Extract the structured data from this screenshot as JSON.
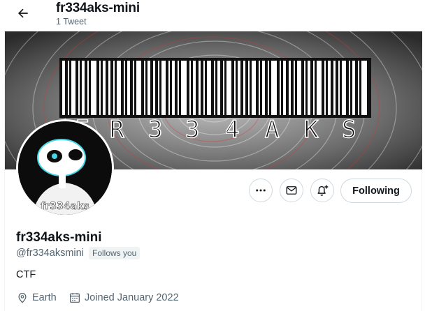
{
  "header": {
    "title": "fr334aks-mini",
    "subtitle": "1 Tweet"
  },
  "banner": {
    "text": "FR334AKS"
  },
  "avatar": {
    "caption": "fr334aks"
  },
  "actions": {
    "following_label": "Following"
  },
  "profile": {
    "display_name": "fr334aks-mini",
    "handle": "@fr334aksmini",
    "follows_you": "Follows you",
    "bio": "CTF",
    "location": "Earth",
    "joined": "Joined January 2022"
  },
  "colors": {
    "text": "#0f1419",
    "secondary": "#536471",
    "border": "#cfd9de",
    "badge_bg": "#eff3f4"
  },
  "icons": [
    "back-arrow-icon",
    "more-icon",
    "message-icon",
    "notification-bell-icon",
    "location-pin-icon",
    "calendar-icon"
  ]
}
